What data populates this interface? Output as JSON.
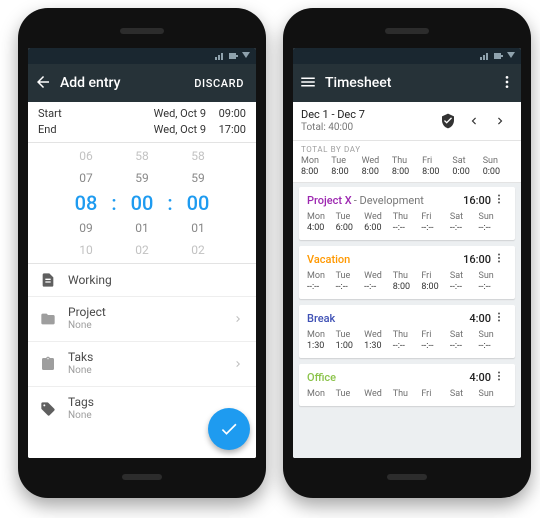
{
  "left": {
    "toolbar": {
      "title": "Add entry",
      "discard": "DISCARD"
    },
    "start": {
      "label": "Start",
      "date": "Wed, Oct 9",
      "time": "09:00"
    },
    "end": {
      "label": "End",
      "date": "Wed, Oct 9",
      "time": "17:00"
    },
    "picker": {
      "r0": {
        "h": "06",
        "m": "58",
        "s": "58"
      },
      "r1": {
        "h": "07",
        "m": "59",
        "s": "59"
      },
      "r2": {
        "h": "08",
        "m": "00",
        "s": "00"
      },
      "r3": {
        "h": "09",
        "m": "01",
        "s": "01"
      },
      "r4": {
        "h": "10",
        "m": "02",
        "s": "02"
      },
      "sep": ":"
    },
    "working": "Working",
    "project": {
      "label": "Project",
      "value": "None"
    },
    "task": {
      "label": "Taks",
      "value": "None"
    },
    "tags": {
      "label": "Tags",
      "value": "None"
    }
  },
  "right": {
    "toolbar": {
      "title": "Timesheet"
    },
    "range": "Dec 1 - Dec 7",
    "total": "Total: 40:00",
    "totalByDay": "TOTAL BY DAY",
    "days": [
      "Mon",
      "Tue",
      "Wed",
      "Thu",
      "Fri",
      "Sat",
      "Sun"
    ],
    "dayTotals": [
      "8:00",
      "8:00",
      "8:00",
      "8:00",
      "8:00",
      "0:00",
      "0:00"
    ],
    "cards": [
      {
        "name": "Project X",
        "suffix": " - Development",
        "color": "pX",
        "total": "16:00",
        "vals": [
          "4:00",
          "6:00",
          "6:00",
          "--:--",
          "--:--",
          "--:--",
          "--:--"
        ]
      },
      {
        "name": "Vacation",
        "suffix": "",
        "color": "pV",
        "total": "16:00",
        "vals": [
          "--:--",
          "--:--",
          "--:--",
          "8:00",
          "8:00",
          "--:--",
          "--:--"
        ]
      },
      {
        "name": "Break",
        "suffix": "",
        "color": "pB",
        "total": "4:00",
        "vals": [
          "1:30",
          "1:00",
          "1:30",
          "--:--",
          "--:--",
          "--:--",
          "--:--"
        ]
      },
      {
        "name": "Office",
        "suffix": "",
        "color": "pO",
        "total": "4:00",
        "vals": [
          "",
          "",
          "",
          "",
          "",
          "",
          ""
        ]
      }
    ]
  }
}
